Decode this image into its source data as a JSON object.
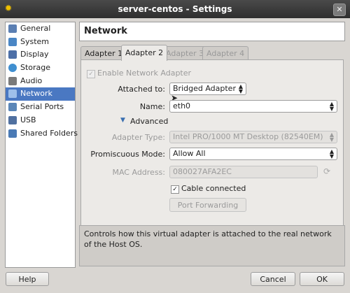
{
  "window": {
    "title": "server-centos - Settings"
  },
  "sidebar": {
    "items": [
      {
        "label": "General",
        "color": "#5b7fb3"
      },
      {
        "label": "System",
        "color": "#4a86c5"
      },
      {
        "label": "Display",
        "color": "#4c6fa7"
      },
      {
        "label": "Storage",
        "color": "#3f8fd0"
      },
      {
        "label": "Audio",
        "color": "#7a7a7a"
      },
      {
        "label": "Network",
        "color": "#3a6fb0"
      },
      {
        "label": "Serial Ports",
        "color": "#5a86b8"
      },
      {
        "label": "USB",
        "color": "#5070a0"
      },
      {
        "label": "Shared Folders",
        "color": "#4a7ab5"
      }
    ]
  },
  "page": {
    "title": "Network"
  },
  "tabs": [
    {
      "label": "Adapter 1"
    },
    {
      "label": "Adapter 2"
    },
    {
      "label": "Adapter 3"
    },
    {
      "label": "Adapter 4"
    }
  ],
  "form": {
    "enable_label": "Enable Network Adapter",
    "attached_label": "Attached to:",
    "attached_value": "Bridged Adapter",
    "name_label": "Name:",
    "name_value": "eth0",
    "advanced_label": "Advanced",
    "adapter_type_label": "Adapter Type:",
    "adapter_type_value": "Intel PRO/1000 MT Desktop (82540EM)",
    "promiscuous_label": "Promiscuous Mode:",
    "promiscuous_value": "Allow All",
    "mac_label": "MAC Address:",
    "mac_value": "080027AFA2EC",
    "cable_label": "Cable connected",
    "port_forwarding_label": "Port Forwarding"
  },
  "description": "Controls how this virtual adapter is attached to the real network of the Host OS.",
  "buttons": {
    "help": "Help",
    "cancel": "Cancel",
    "ok": "OK"
  }
}
